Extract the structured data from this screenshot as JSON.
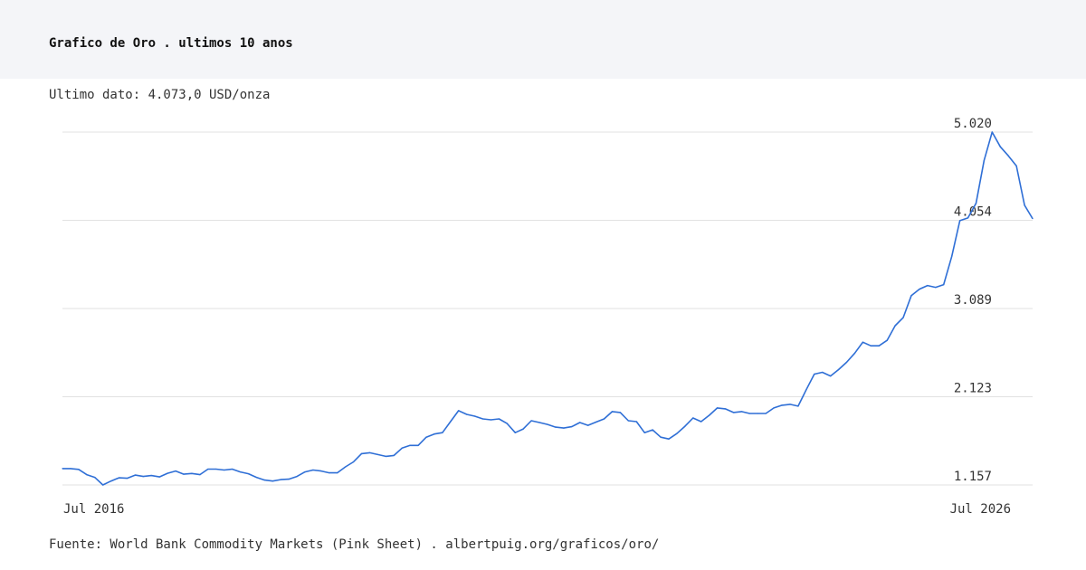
{
  "header": {
    "title": "Grafico de Oro . ultimos 10 anos"
  },
  "subtitle": "Ultimo dato: 4.073,0 USD/onza",
  "footer": "Fuente: World Bank Commodity Markets (Pink Sheet) . albertpuig.org/graficos/oro/",
  "colors": {
    "line": "#2f6fd6",
    "grid": "#e2e2e2",
    "header_bg": "#f4f5f8"
  },
  "chart_data": {
    "type": "line",
    "ylim": [
      1157,
      5020
    ],
    "y_ticks": [
      1157,
      2123,
      3089,
      4054,
      5020
    ],
    "y_tick_labels": [
      "1.157",
      "2.123",
      "3.089",
      "4.054",
      "5.020"
    ],
    "x_tick_labels": [
      "Jul 2016",
      "Jul 2026"
    ],
    "grid": true,
    "series": [
      {
        "values": [
          1336,
          1336,
          1327,
          1270,
          1240,
          1157,
          1200,
          1235,
          1230,
          1265,
          1250,
          1260,
          1245,
          1285,
          1310,
          1275,
          1283,
          1270,
          1330,
          1330,
          1320,
          1330,
          1300,
          1280,
          1240,
          1210,
          1200,
          1215,
          1220,
          1250,
          1300,
          1320,
          1310,
          1290,
          1290,
          1355,
          1410,
          1500,
          1510,
          1490,
          1470,
          1480,
          1560,
          1590,
          1590,
          1680,
          1715,
          1730,
          1850,
          1970,
          1930,
          1910,
          1880,
          1870,
          1880,
          1830,
          1730,
          1770,
          1860,
          1840,
          1820,
          1790,
          1780,
          1795,
          1840,
          1810,
          1845,
          1880,
          1960,
          1950,
          1860,
          1850,
          1730,
          1760,
          1680,
          1660,
          1720,
          1800,
          1890,
          1850,
          1920,
          2000,
          1990,
          1950,
          1960,
          1940,
          1940,
          1940,
          2000,
          2030,
          2040,
          2020,
          2200,
          2370,
          2390,
          2350,
          2420,
          2500,
          2600,
          2720,
          2680,
          2680,
          2740,
          2900,
          2990,
          3230,
          3300,
          3340,
          3320,
          3350,
          3660,
          4050,
          4080,
          4240,
          4710,
          5020,
          4860,
          4760,
          4650,
          4220,
          4073
        ]
      }
    ]
  }
}
